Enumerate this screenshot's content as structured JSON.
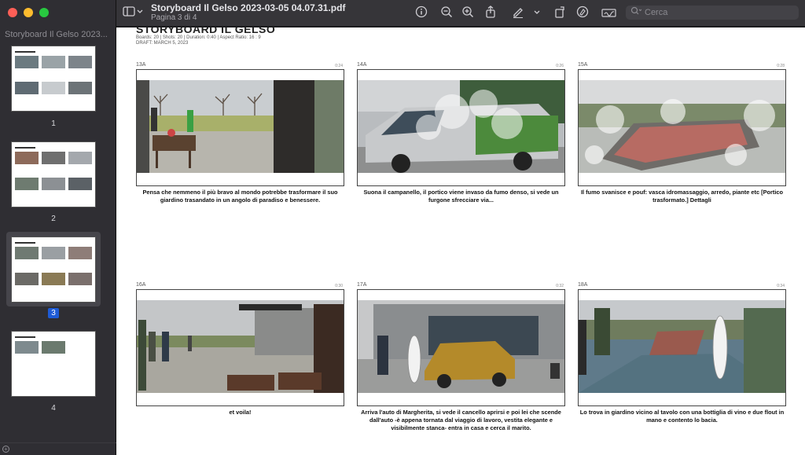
{
  "window": {
    "controls": [
      "close",
      "minimize",
      "zoom"
    ]
  },
  "sidebar": {
    "title": "Storyboard Il Gelso 2023...",
    "pages": [
      {
        "label": "1"
      },
      {
        "label": "2"
      },
      {
        "label": "3",
        "selected": true
      },
      {
        "label": "4"
      }
    ]
  },
  "toolbar": {
    "doc_title": "Storyboard Il Gelso 2023-03-05 04.07.31.pdf",
    "doc_subtitle": "Pagina 3 di 4",
    "search_placeholder": "Cerca",
    "icons": [
      "sidebar-toggle",
      "info",
      "zoom-out",
      "zoom-in",
      "share",
      "markup-pen",
      "rotate",
      "markup-circle",
      "signature",
      "search"
    ]
  },
  "page": {
    "title": "STORYBOARD IL GELSO",
    "meta_line1": "Boards: 20  |  Shots: 20  |  Duration: 0:40  |  Aspect Ratio: 16 : 9",
    "meta_line2": "DRAFT: MARCH 5, 2023",
    "frames": [
      {
        "id": "13A",
        "num": "0:24",
        "caption": "Pensa che nemmeno il più bravo al mondo potrebbe trasformare il suo giardino trasandato in un angolo di paradiso e benessere."
      },
      {
        "id": "14A",
        "num": "0:26",
        "caption": "Suona il campanello, il portico viene invaso da fumo denso, si vede un furgone sfrecciare via..."
      },
      {
        "id": "15A",
        "num": "0:28",
        "caption": "Il fumo svanisce e pouf: vasca idromassaggio, arredo, piante etc [Portico trasformato.] Dettagli"
      },
      {
        "id": "16A",
        "num": "0:30",
        "caption": "et voila!"
      },
      {
        "id": "17A",
        "num": "0:32",
        "caption": "Arriva l'auto di Margherita, si vede il cancello aprirsi e poi lei che scende dall'auto -è appena tornata dal viaggio di lavoro, vestita elegante e visibilmente stanca- entra in casa e cerca il marito."
      },
      {
        "id": "18A",
        "num": "0:34",
        "caption": "Lo trova in giardino vicino al tavolo con una bottiglia di vino e due flout in mano e contento lo bacia."
      }
    ]
  }
}
